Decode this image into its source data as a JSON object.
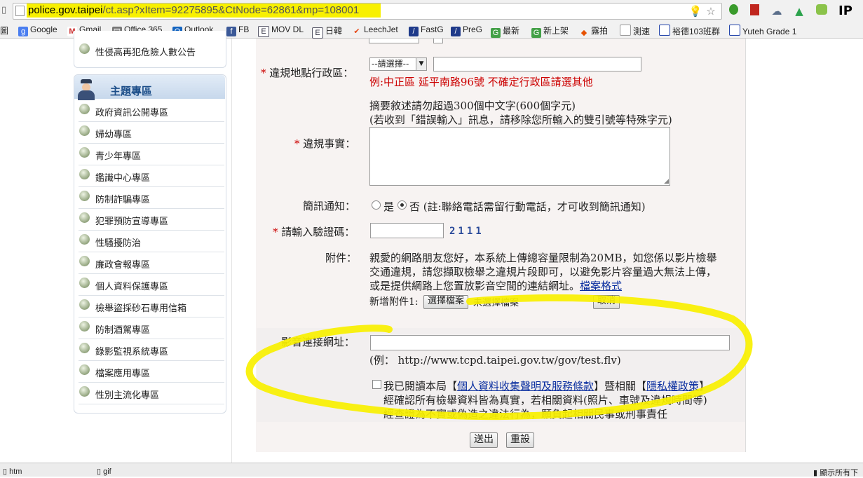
{
  "browser": {
    "url_host": "police.gov.taipei",
    "url_path": "/ct.asp?xItem=92275895&CtNode=62861&mp=108001",
    "ip_label": "IP",
    "bookmarks": [
      "Google",
      "Gmail",
      "Office 365",
      "Outlook",
      "FB",
      "MOV DL",
      "日韓",
      "LeechJet",
      "FastG",
      "PreG",
      "最新",
      "新上架",
      "露拍",
      "測速",
      "裕德103班群",
      "Yuteh Grade 1"
    ]
  },
  "sidebar": {
    "top_item": "性侵高再犯危險人數公告",
    "section_title": "主題專區",
    "items": [
      "政府資訊公開專區",
      "婦幼專區",
      "青少年專區",
      "鑑識中心專區",
      "防制詐騙專區",
      "犯罪預防宣導專區",
      "性騷擾防治",
      "廉政會報專區",
      "個人資料保護專區",
      "檢舉盜採砂石專用信箱",
      "防制酒駕專區",
      "錄影監視系統專區",
      "檔案應用專區",
      "性別主流化專區"
    ]
  },
  "form": {
    "district_label": "違規地點行政區：",
    "district_select": "--請選擇--",
    "district_hint": "例:中正區 延平南路96號 不確定行政區請選其他",
    "summary_note_1": "摘要敘述請勿超過300個中文字(600個字元)",
    "summary_note_2": "(若收到「錯誤輸入」訊息，請移除您所輸入的雙引號等特殊字元)",
    "facts_label": "違規事實：",
    "sms_label": "簡訊通知：",
    "sms_yes": "是",
    "sms_no": "否",
    "sms_note": "(註:聯絡電話需留行動電話，才可收到簡訊通知)",
    "captcha_label": "請輸入驗證碼：",
    "captcha_code": "2111",
    "attach_label": "附件：",
    "attach_note_1": "親愛的網路朋友您好，本系統上傳總容量限制為20MB，如您係以影片檢舉",
    "attach_note_2": "交通違規，請您擷取檢舉之違規片段即可，以避免影片容量過大無法上傳，",
    "attach_note_3": "或是提供網路上您置放影音空間的連結網址。",
    "attach_format_link": "檔案格式",
    "new_attach_label": "新增附件1:",
    "choose_file": "選擇檔案",
    "no_file": "未選擇檔案",
    "cancel": "取消",
    "video_url_label": "影音連接網址：",
    "video_url_example": "(例： http://www.tcpd.taipei.gov.tw/gov/test.flv)",
    "agree_prefix": "我已閱讀本局【",
    "agree_link_1": "個人資料收集聲明及服務條款",
    "agree_mid": "】暨相關【",
    "agree_link_2": "隱私權政策",
    "agree_suffix": "】",
    "agree_line_2": "經確認所有檢舉資料皆為真實，若相關資料(照片、車號及違規時間等)",
    "agree_line_3": "經查證為不實或偽造之違法行為，願負起相關民事或刑事責任",
    "submit": "送出",
    "reset": "重設"
  },
  "statusbar": {
    "download_1": "htm",
    "download_2": "gif",
    "show_all": "顯示所有下"
  },
  "colors": {
    "highlight": "#f8f000",
    "required": "#cc0000",
    "link": "#0b2fa0",
    "hint": "#cc0000"
  }
}
